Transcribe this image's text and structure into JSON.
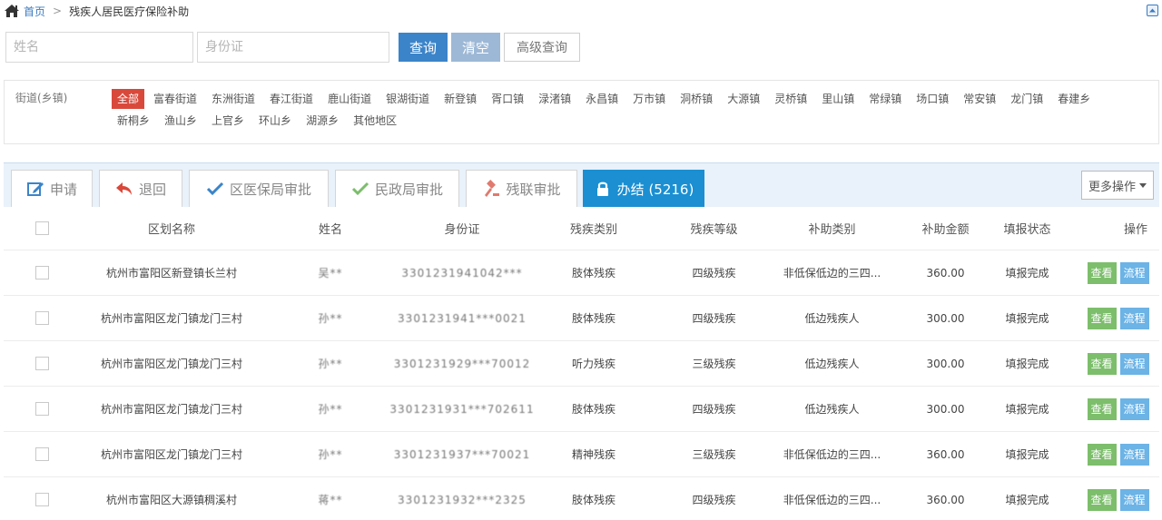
{
  "breadcrumb": {
    "home": "首页",
    "separator": ">",
    "current": "残疾人居民医疗保险补助"
  },
  "search": {
    "name_placeholder": "姓名",
    "id_placeholder": "身份证",
    "query_label": "查询",
    "clear_label": "清空",
    "advanced_label": "高级查询"
  },
  "street": {
    "label": "街道(乡镇)",
    "tags": [
      "全部",
      "富春街道",
      "东洲街道",
      "春江街道",
      "鹿山街道",
      "银湖街道",
      "新登镇",
      "胥口镇",
      "渌渚镇",
      "永昌镇",
      "万市镇",
      "洞桥镇",
      "大源镇",
      "灵桥镇",
      "里山镇",
      "常绿镇",
      "场口镇",
      "常安镇",
      "龙门镇",
      "春建乡",
      "新桐乡",
      "渔山乡",
      "上官乡",
      "环山乡",
      "湖源乡",
      "其他地区"
    ],
    "active_index": 0
  },
  "tabs": [
    {
      "label": "申请",
      "icon": "edit-icon"
    },
    {
      "label": "退回",
      "icon": "undo-icon"
    },
    {
      "label": "区医保局审批",
      "icon": "check-icon"
    },
    {
      "label": "民政局审批",
      "icon": "check-icon"
    },
    {
      "label": "残联审批",
      "icon": "gavel-icon"
    },
    {
      "label": "办结 (5216)",
      "icon": "lock-icon"
    }
  ],
  "active_tab": 5,
  "more_actions": "更多操作",
  "table": {
    "columns": [
      "区划名称",
      "姓名",
      "身份证",
      "残疾类别",
      "残疾等级",
      "补助类别",
      "补助金额",
      "填报状态",
      "操作"
    ],
    "rows": [
      [
        "杭州市富阳区新登镇长兰村",
        "吴**",
        "3301231941042***",
        "肢体残疾",
        "四级残疾",
        "非低保低边的三四...",
        "360.00",
        "填报完成"
      ],
      [
        "杭州市富阳区龙门镇龙门三村",
        "孙**",
        "3301231941***0021",
        "肢体残疾",
        "四级残疾",
        "低边残疾人",
        "300.00",
        "填报完成"
      ],
      [
        "杭州市富阳区龙门镇龙门三村",
        "孙**",
        "3301231929***70012",
        "听力残疾",
        "三级残疾",
        "低边残疾人",
        "300.00",
        "填报完成"
      ],
      [
        "杭州市富阳区龙门镇龙门三村",
        "孙**",
        "3301231931***702611",
        "肢体残疾",
        "四级残疾",
        "低边残疾人",
        "300.00",
        "填报完成"
      ],
      [
        "杭州市富阳区龙门镇龙门三村",
        "孙**",
        "3301231937***70021",
        "精神残疾",
        "三级残疾",
        "非低保低边的三四...",
        "360.00",
        "填报完成"
      ],
      [
        "杭州市富阳区大源镇稠溪村",
        "蒋**",
        "3301231932***2325",
        "肢体残疾",
        "四级残疾",
        "非低保低边的三四...",
        "360.00",
        "填报完成"
      ]
    ],
    "view_label": "查看",
    "flow_label": "流程"
  }
}
